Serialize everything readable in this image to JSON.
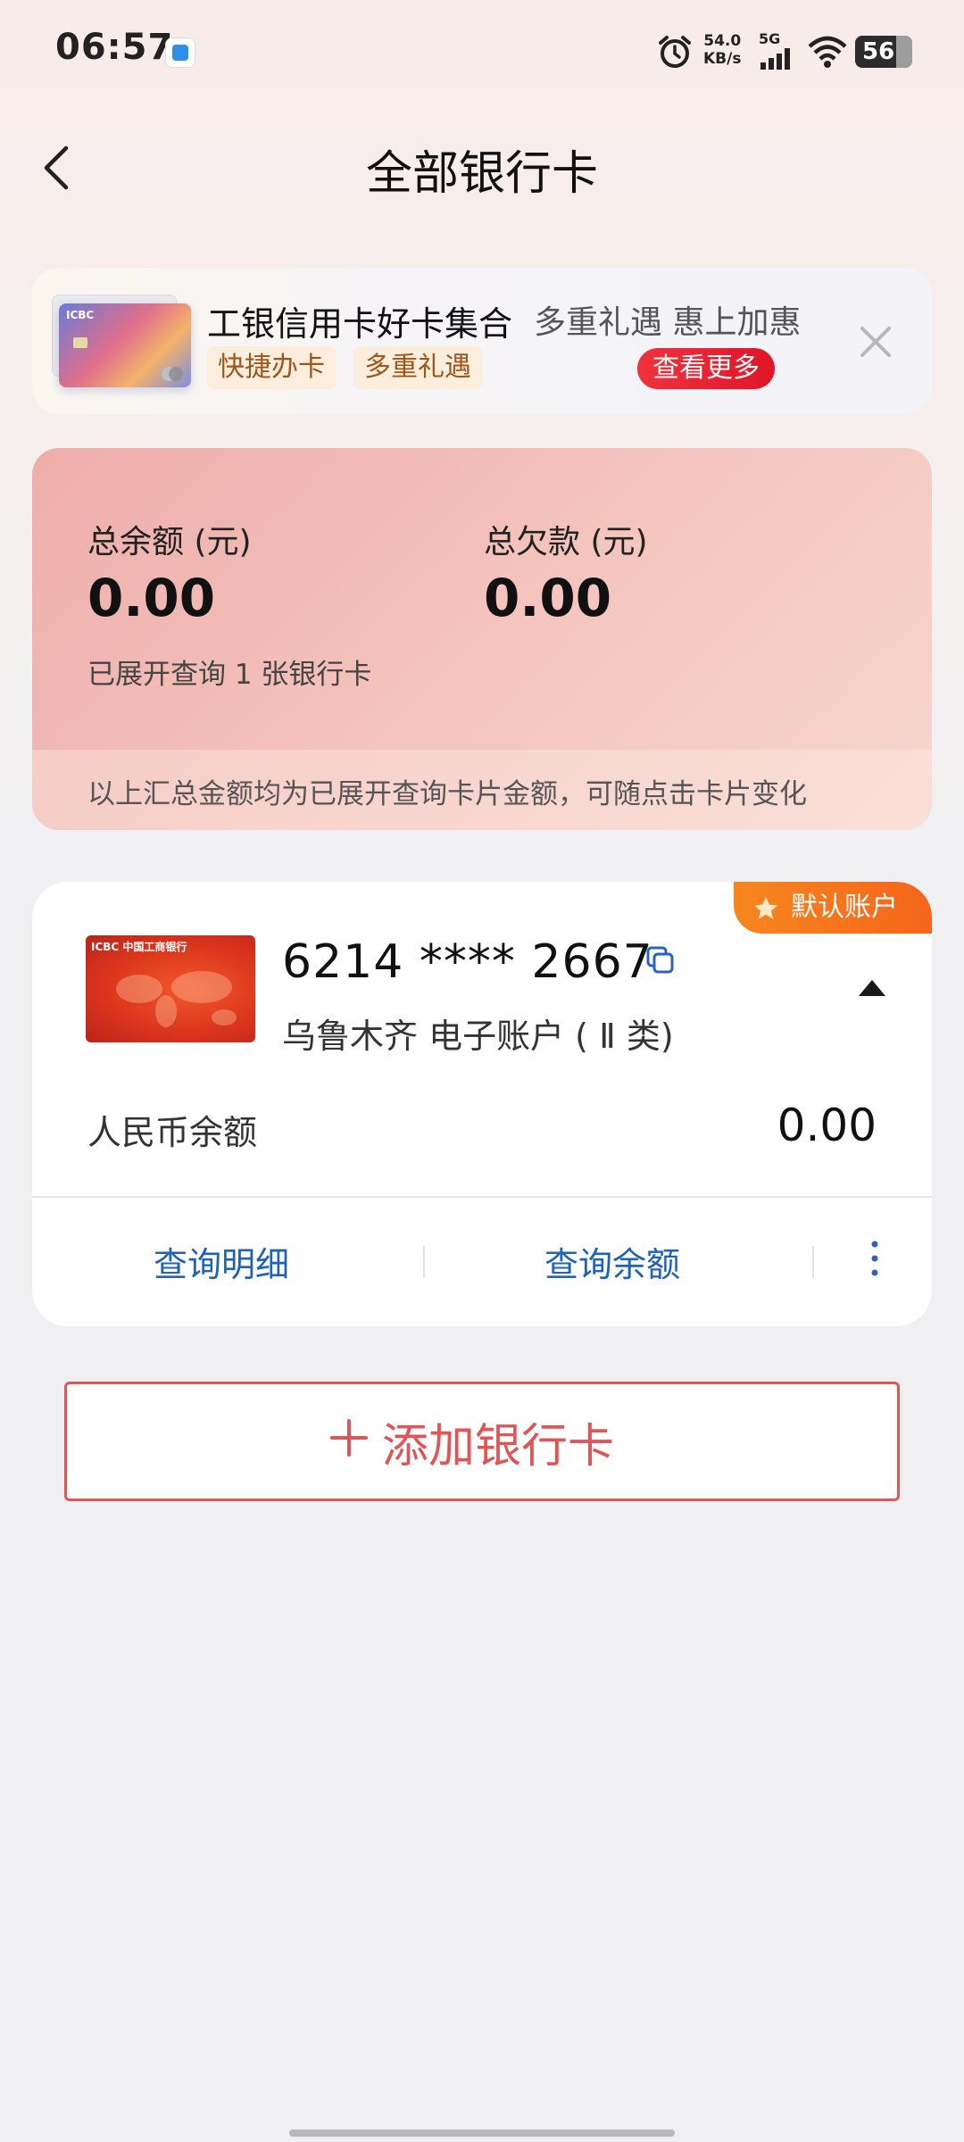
{
  "status_bar": {
    "time": "06:57",
    "net_speed_value": "54.0",
    "net_speed_unit": "KB/s",
    "network_type": "5G",
    "battery_level": "56",
    "icons": [
      "app-notification-icon",
      "alarm-icon",
      "signal-icon",
      "wifi-icon",
      "battery-icon"
    ]
  },
  "header": {
    "title": "全部银行卡",
    "back_icon": "chevron-left-icon"
  },
  "promo": {
    "title": "工银信用卡好卡集合",
    "subtitle": "多重礼遇 惠上加惠",
    "tags": [
      "快捷办卡",
      "多重礼遇"
    ],
    "more_label": "查看更多",
    "card_logo": "ICBC",
    "close_icon": "close-icon"
  },
  "summary": {
    "balance_label": "总余额 (元)",
    "balance_value": "0.00",
    "debt_label": "总欠款 (元)",
    "debt_value": "0.00",
    "count_text": "已展开查询 1 张银行卡",
    "note": "以上汇总金额均为已展开查询卡片金额，可随点击卡片变化"
  },
  "bank_card": {
    "default_badge": "默认账户",
    "bank_logo_text": "ICBC 中国工商银行",
    "card_number": "6214 **** 2667",
    "description": "乌鲁木齐 电子账户 ( Ⅱ 类)",
    "rmb_label": "人民币余额",
    "rmb_value": "0.00",
    "actions": [
      "查询明细",
      "查询余额"
    ]
  },
  "add_card": {
    "label": "添加银行卡"
  },
  "colors": {
    "accent_red": "#e05555",
    "link_blue": "#1e63b8",
    "badge_orange": "#f5651a",
    "promo_button_red": "#e01528"
  }
}
